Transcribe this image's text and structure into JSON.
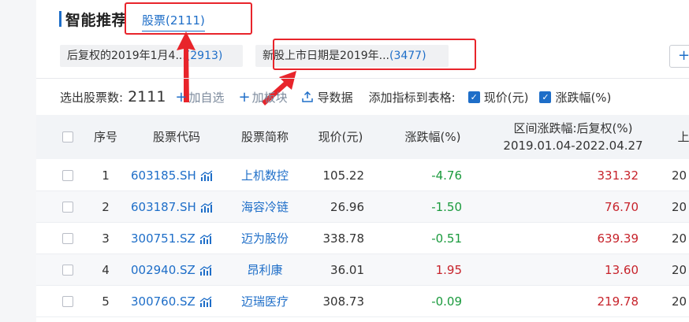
{
  "header": {
    "title": "智能推荐",
    "stock_tab_label": "股票",
    "stock_tab_count": "(2111)"
  },
  "chips": [
    {
      "label": "后复权的2019年1月4...",
      "count": "(2913)"
    },
    {
      "label": "新股上市日期是2019年...",
      "count": "(3477)"
    }
  ],
  "plus_button": "+",
  "toolbar": {
    "selected_label": "选出股票数:",
    "selected_count": "2111",
    "add_watchlist": "加自选",
    "add_block": "加板块",
    "export": "导数据",
    "add_indicator_label": "添加指标到表格:",
    "check_price": "现价(元)",
    "check_change": "涨跌幅(%)"
  },
  "table": {
    "headers": {
      "index": "序号",
      "code": "股票代码",
      "name": "股票简称",
      "price": "现价(元)",
      "change": "涨跌幅(%)",
      "range_line1": "区间涨跌幅:后复权(%)",
      "range_line2": "2019.01.04-2022.04.27",
      "next": "上"
    },
    "rows": [
      {
        "index": "1",
        "code": "603185.SH",
        "name": "上机数控",
        "price": "105.22",
        "change": "-4.76",
        "range": "331.32",
        "next": "20"
      },
      {
        "index": "2",
        "code": "603187.SH",
        "name": "海容冷链",
        "price": "26.96",
        "change": "-1.50",
        "range": "76.70",
        "next": "20"
      },
      {
        "index": "3",
        "code": "300751.SZ",
        "name": "迈为股份",
        "price": "338.78",
        "change": "-0.51",
        "range": "639.39",
        "next": "20"
      },
      {
        "index": "4",
        "code": "002940.SZ",
        "name": "昂利康",
        "price": "36.01",
        "change": "1.95",
        "range": "13.60",
        "next": "20"
      },
      {
        "index": "5",
        "code": "300760.SZ",
        "name": "迈瑞医疗",
        "price": "308.73",
        "change": "-0.09",
        "range": "219.78",
        "next": "20"
      }
    ]
  },
  "colors": {
    "accent": "#1e6ec8",
    "annotation_red": "#e8242b",
    "negative_green": "#1a9a3d",
    "positive_red": "#c7232b"
  }
}
